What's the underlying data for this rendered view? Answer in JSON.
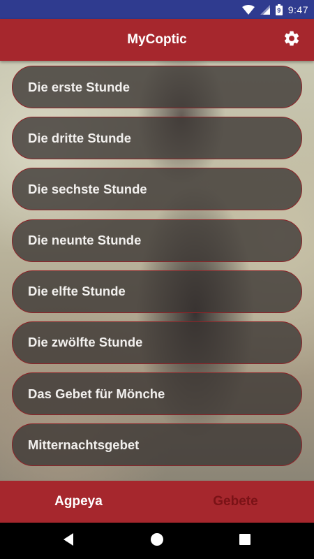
{
  "status_bar": {
    "time": "9:47",
    "battery_level": "9"
  },
  "app_bar": {
    "title": "MyCoptic",
    "settings_icon": "gear-icon"
  },
  "hours": [
    {
      "label": "Die erste Stunde"
    },
    {
      "label": "Die dritte Stunde"
    },
    {
      "label": "Die sechste Stunde"
    },
    {
      "label": "Die neunte Stunde"
    },
    {
      "label": "Die elfte Stunde"
    },
    {
      "label": "Die zwölfte Stunde"
    },
    {
      "label": "Das Gebet für Mönche"
    },
    {
      "label": "Mitternachtsgebet"
    }
  ],
  "bottom_nav": {
    "tabs": [
      {
        "label": "Agpeya",
        "active": true
      },
      {
        "label": "Gebete",
        "active": false
      }
    ]
  },
  "colors": {
    "status_bar": "#2f3b8f",
    "app_bar": "#a6272d",
    "item_border": "#8e2328",
    "inactive_tab": "#7a1216"
  }
}
